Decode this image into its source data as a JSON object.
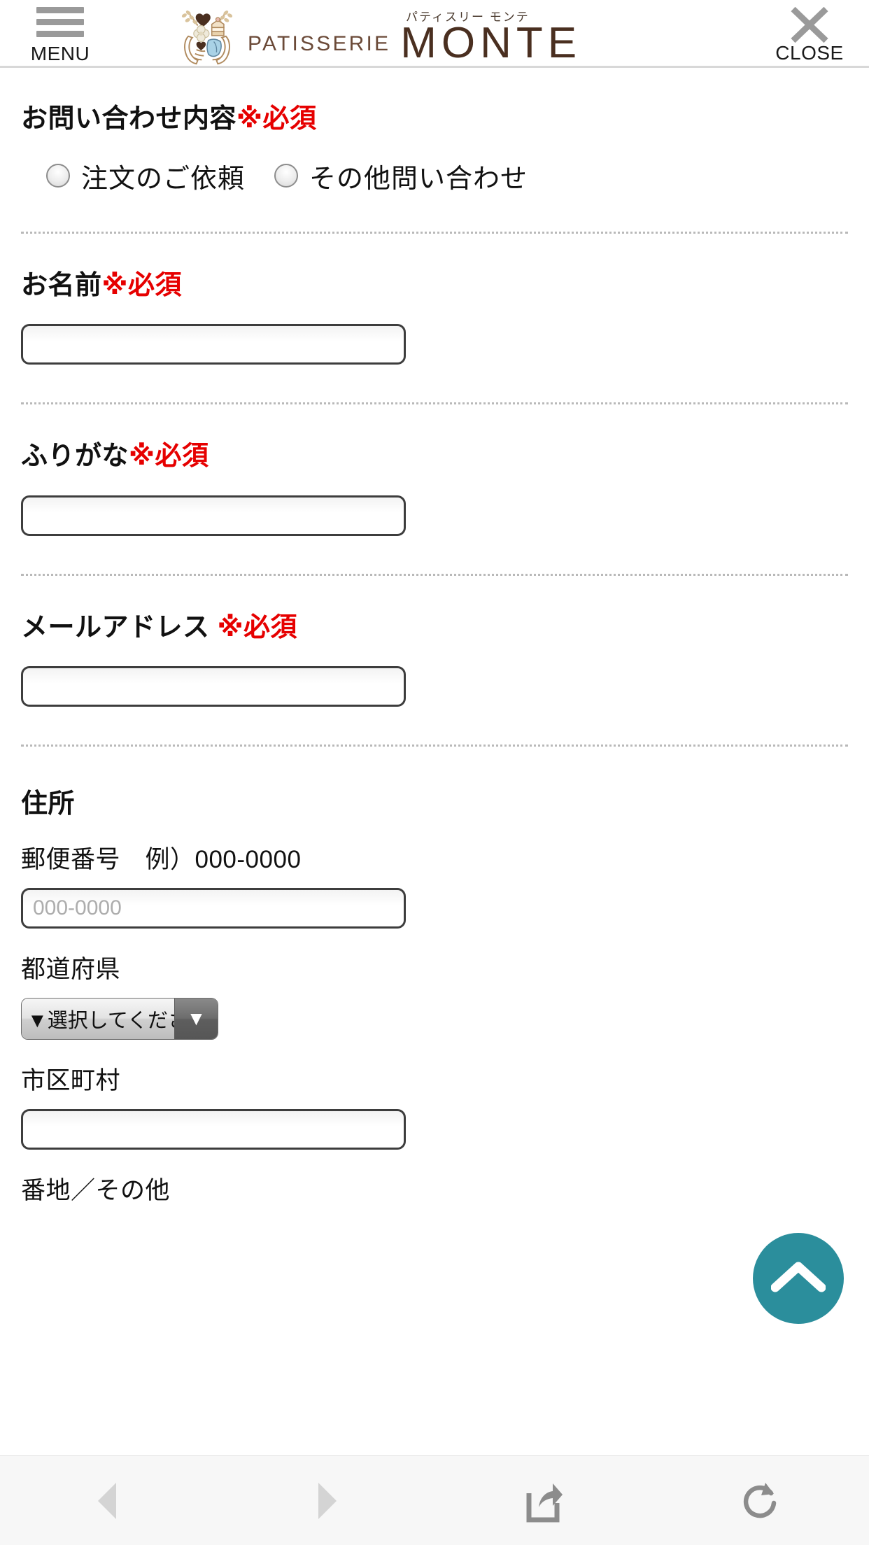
{
  "header": {
    "menu_label": "MENU",
    "close_label": "CLOSE",
    "logo_kana": "パティスリー モンテ",
    "logo_patisserie": "PATISSERIE",
    "logo_monte": "MONTE"
  },
  "form": {
    "inquiry": {
      "label": "お問い合わせ内容",
      "required": "※必須",
      "options": [
        {
          "label": "注文のご依頼"
        },
        {
          "label": "その他問い合わせ"
        }
      ]
    },
    "name": {
      "label": "お名前",
      "required": "※必須",
      "value": "",
      "placeholder": ""
    },
    "furigana": {
      "label": "ふりがな",
      "required": "※必須",
      "value": "",
      "placeholder": ""
    },
    "email": {
      "label": "メールアドレス ",
      "required": "※必須",
      "value": "",
      "placeholder": ""
    },
    "address": {
      "section_label": "住所",
      "postal_label": "郵便番号　例）000-0000",
      "postal_placeholder": "000-0000",
      "postal_value": "",
      "prefecture_label": "都道府県",
      "prefecture_selected": "▼選択してください",
      "city_label": "市区町村",
      "city_value": "",
      "city_placeholder": "",
      "street_label": "番地／その他"
    }
  },
  "scroll_top": {
    "color": "#2b8e9c",
    "icon": "chevron-up-icon"
  },
  "browser_bar": {
    "items": [
      {
        "icon": "back-arrow-icon"
      },
      {
        "icon": "forward-arrow-icon"
      },
      {
        "icon": "share-icon"
      },
      {
        "icon": "reload-icon"
      }
    ]
  }
}
